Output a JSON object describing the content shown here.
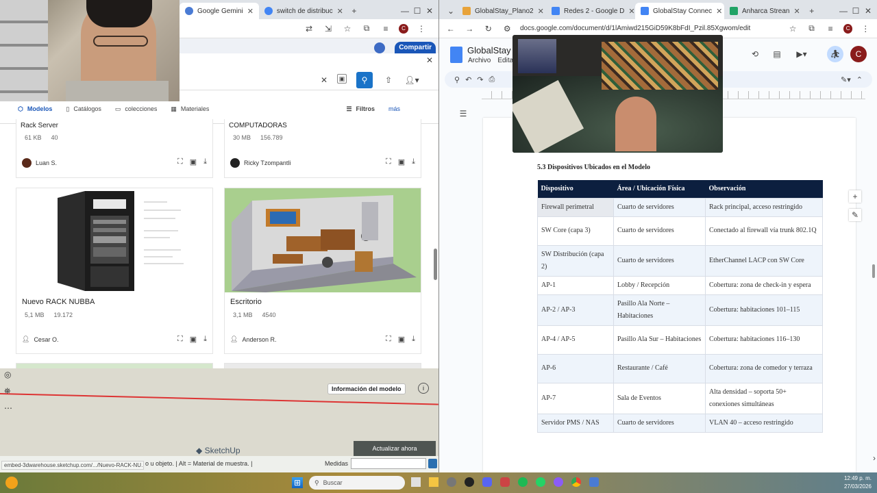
{
  "left_browser": {
    "tabs": [
      {
        "label": "Google Gemini",
        "color": "#4a7bd4"
      },
      {
        "label": "switch de distribuc",
        "color": "#4285f4"
      }
    ],
    "share_button": "Compartir",
    "nav": {
      "models": "Modelos",
      "catalogs": "Catálogos",
      "collections": "colecciones",
      "materials": "Materiales",
      "filters": "Filtros",
      "more": "más"
    },
    "cards": [
      {
        "name": "Rack Server",
        "size": "61 KB",
        "count": "40",
        "author": "Luan S."
      },
      {
        "name": "COMPUTADORAS",
        "size": "30 MB",
        "count": "156.789",
        "author": "Ricky Tzompantli"
      },
      {
        "name": "Nuevo RACK NUBBA",
        "size": "5,1 MB",
        "count": "19.172",
        "author": "Cesar O."
      },
      {
        "name": "Escritorio",
        "size": "3,1 MB",
        "count": "4540",
        "author": "Anderson R."
      }
    ],
    "sketchup": {
      "model_info": "Información del modelo",
      "update_now": "Actualizar ahora",
      "brand": "SketchUp",
      "status_text": "o u objeto. | Alt = Material de muestra. |",
      "status_url": "embed-3dwarehouse.sketchup.com/.../Nuevo-RACK-NU...",
      "measures_label": "Medidas"
    }
  },
  "right_browser": {
    "tabs": [
      {
        "label": "GlobalStay_Plano2",
        "color": "#e8a33a"
      },
      {
        "label": "Redes 2 - Google D",
        "color": "#4285f4"
      },
      {
        "label": "GlobalStay Connec",
        "color": "#4285f4"
      },
      {
        "label": "Anharca Strean",
        "color": "#21a366"
      }
    ],
    "url": "docs.google.com/document/d/1lAmiwd215GiD59K8bFdI_Pzil.85Xgwom/edit",
    "doc_title": "GlobalStay C",
    "menu": [
      "Archivo",
      "Editar"
    ],
    "avatar_letter": "C",
    "section_title": "5.3 Dispositivos Ubicados en el Modelo",
    "table": {
      "headers": [
        "Dispositivo",
        "Área / Ubicación Física",
        "Observación"
      ],
      "rows": [
        [
          "Firewall perimetral",
          "Cuarto de servidores",
          "Rack principal, acceso restringido"
        ],
        [
          "SW Core (capa 3)",
          "Cuarto de servidores",
          "Conectado al firewall vía trunk 802.1Q"
        ],
        [
          "SW Distribución (capa 2)",
          "Cuarto de servidores",
          "EtherChannel LACP con SW Core"
        ],
        [
          "AP-1",
          "Lobby / Recepción",
          "Cobertura: zona de check-in y espera"
        ],
        [
          "AP-2 / AP-3",
          "Pasillo Ala Norte – Habitaciones",
          "Cobertura: habitaciones 101–115"
        ],
        [
          "AP-4 / AP-5",
          "Pasillo Ala Sur – Habitaciones",
          "Cobertura: habitaciones 116–130"
        ],
        [
          "AP-6",
          "Restaurante / Café",
          "Cobertura: zona de comedor y terraza"
        ],
        [
          "AP-7",
          "Sala de Eventos",
          "Alta densidad – soporta 50+ conexiones simultáneas"
        ],
        [
          "Servidor PMS / NAS",
          "Cuarto de servidores",
          "VLAN 40 – acceso restringido"
        ]
      ]
    }
  },
  "taskbar": {
    "search_placeholder": "Buscar",
    "time": "12:49 p. m.",
    "date": "27/03/2026"
  }
}
